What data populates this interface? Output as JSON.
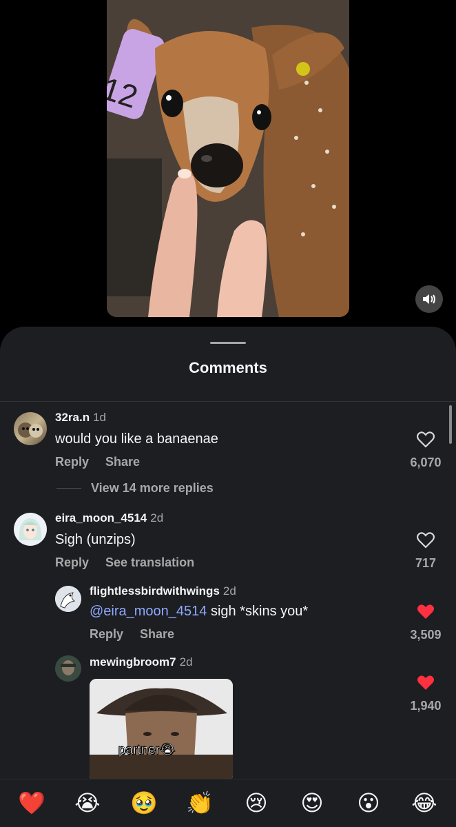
{
  "video": {
    "tag_number": "12",
    "mute_icon": "speaker-icon"
  },
  "sheet": {
    "title": "Comments"
  },
  "comments": [
    {
      "user": "32ra.n",
      "time": "1d",
      "text": "would you like a banaenae",
      "actions": [
        "Reply",
        "Share"
      ],
      "likes": "6,070",
      "liked": false,
      "view_replies": "View 14 more replies"
    },
    {
      "user": "eira_moon_4514",
      "time": "2d",
      "text": "Sigh (unzips)",
      "actions": [
        "Reply",
        "See translation"
      ],
      "likes": "717",
      "liked": false
    }
  ],
  "replies": [
    {
      "user": "flightlessbirdwithwings",
      "time": "2d",
      "mention": "@eira_moon_4514",
      "text": " sigh *skins you*",
      "actions": [
        "Reply",
        "Share"
      ],
      "likes": "3,509",
      "liked": true
    },
    {
      "user": "mewingbroom7",
      "time": "2d",
      "gif_caption": "partner😭",
      "likes": "1,940",
      "liked": true
    }
  ],
  "emoji_bar": [
    "❤️",
    "😭",
    "🥹",
    "👏",
    "😢",
    "😍",
    "😮",
    "😂"
  ],
  "colors": {
    "sheet_bg": "#1c1e22",
    "like_red": "#ff3040",
    "mention_blue": "#8fa9ff",
    "muted_text": "#a8a8a8"
  }
}
